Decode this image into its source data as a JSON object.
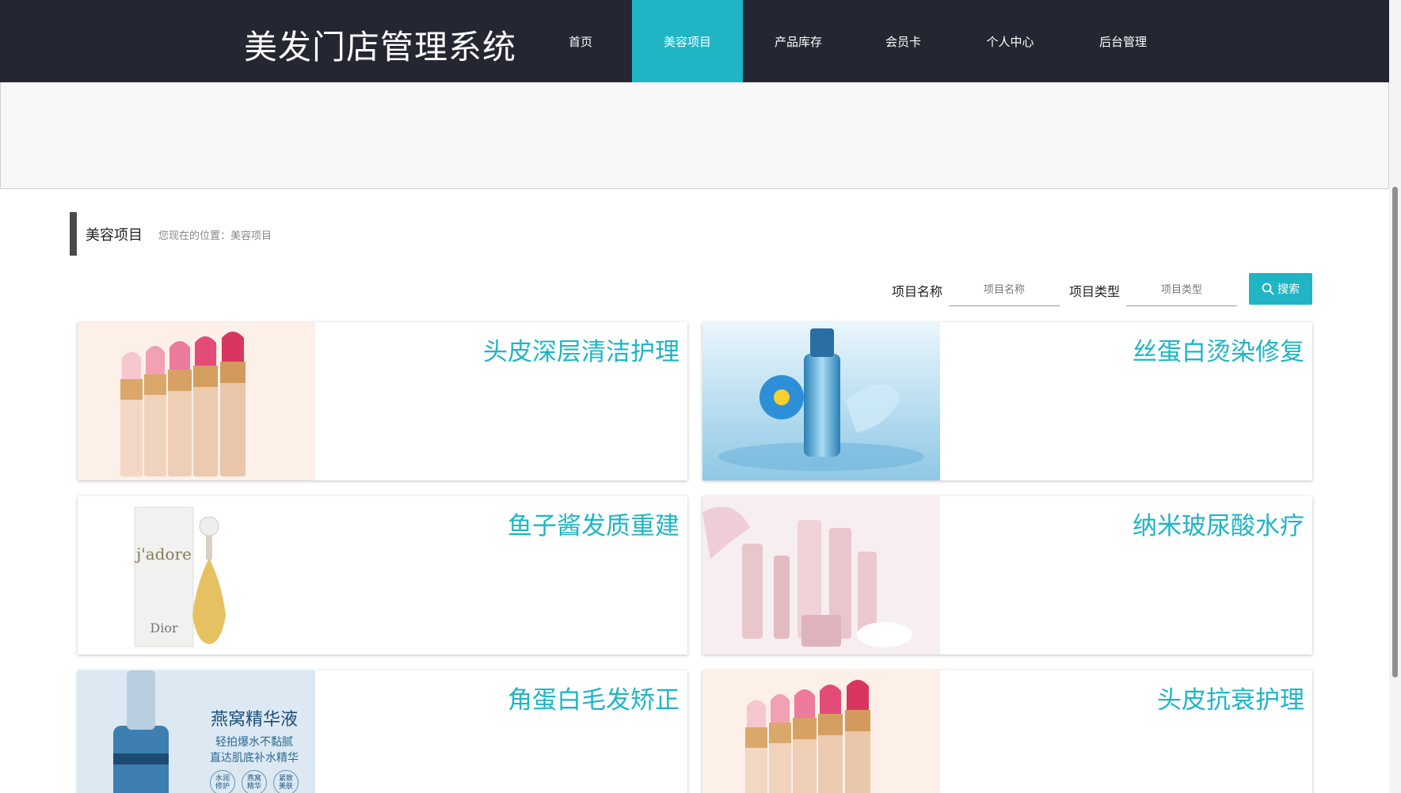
{
  "header": {
    "logo": "美发门店管理系统",
    "nav": [
      {
        "label": "首页",
        "active": false
      },
      {
        "label": "美容项目",
        "active": true
      },
      {
        "label": "产品库存",
        "active": false
      },
      {
        "label": "会员卡",
        "active": false
      },
      {
        "label": "个人中心",
        "active": false
      },
      {
        "label": "后台管理",
        "active": false
      }
    ]
  },
  "page": {
    "title": "美容项目",
    "breadcrumb": "您现在的位置：美容项目"
  },
  "search": {
    "name_label": "项目名称",
    "name_placeholder": "项目名称",
    "type_label": "项目类型",
    "type_placeholder": "项目类型",
    "button_label": "搜索"
  },
  "items": [
    {
      "title": "头皮深层清洁护理",
      "image": "lipsticks"
    },
    {
      "title": "丝蛋白烫染修复",
      "image": "blue-bottle"
    },
    {
      "title": "鱼子酱发质重建",
      "image": "perfume"
    },
    {
      "title": "纳米玻尿酸水疗",
      "image": "pink-skincare-set"
    },
    {
      "title": "角蛋白毛发矫正",
      "image": "serum-ad",
      "ad_text": {
        "headline": "燕窝精华液",
        "line1": "轻拍爆水不黏腻",
        "line2": "直达肌底补水精华",
        "badges": [
          "水润修护",
          "燕窝精华",
          "紧致美肤"
        ]
      }
    },
    {
      "title": "头皮抗衰护理",
      "image": "lipsticks"
    }
  ],
  "colors": {
    "header_bg": "#242732",
    "accent": "#1fb5c5"
  }
}
